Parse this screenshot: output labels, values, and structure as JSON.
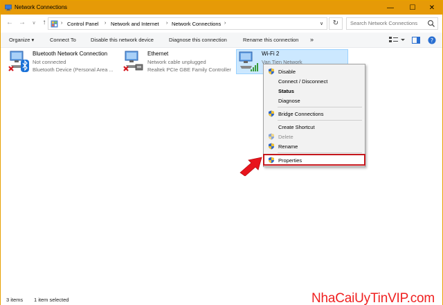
{
  "window": {
    "title": "Network Connections",
    "controls": {
      "minimize": "—",
      "maximize": "☐",
      "close": "✕"
    }
  },
  "address": {
    "crumbs": [
      "Control Panel",
      "Network and Internet",
      "Network Connections"
    ],
    "search_placeholder": "Search Network Connections"
  },
  "toolbar": {
    "organize": "Organize ▾",
    "connect_to": "Connect To",
    "disable": "Disable this network device",
    "diagnose": "Diagnose this connection",
    "rename": "Rename this connection",
    "more": "»"
  },
  "connections": [
    {
      "name": "Bluetooth Network Connection",
      "status": "Not connected",
      "device": "Bluetooth Device (Personal Area ..."
    },
    {
      "name": "Ethernet",
      "status": "Network cable unplugged",
      "device": "Realtek PCIe GBE Family Controller"
    },
    {
      "name": "Wi-Fi 2",
      "status": "Van Tien Network",
      "device": ""
    }
  ],
  "context_menu": {
    "items": [
      "Disable",
      "Connect / Disconnect",
      "Status",
      "Diagnose",
      "Bridge Connections",
      "Create Shortcut",
      "Delete",
      "Rename",
      "Properties"
    ]
  },
  "statusbar": {
    "items_count": "3 items",
    "selected": "1 item selected"
  },
  "watermark": "NhaCaiUyTinVIP.com",
  "colors": {
    "titlebar": "#e69a07",
    "selection": "#cce8ff",
    "highlight_border": "#c4161c",
    "arrow": "#e8141c"
  }
}
